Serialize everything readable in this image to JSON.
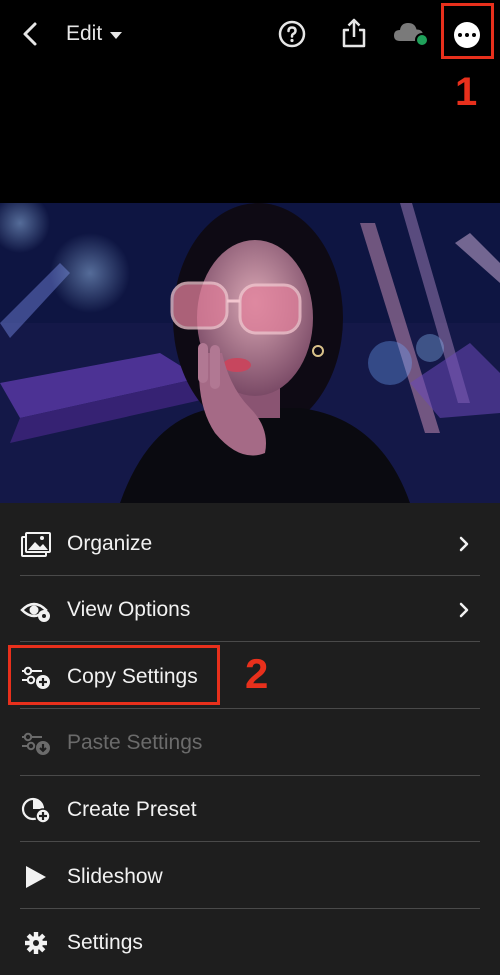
{
  "topbar": {
    "title": "Edit",
    "icons": [
      "back-arrow-icon",
      "caret-down-icon",
      "help-icon",
      "share-icon",
      "cloud-sync-icon",
      "more-icon"
    ],
    "sync_status_color": "#1fa15a"
  },
  "annotations": {
    "step1": "1",
    "step2": "2",
    "color": "#e8301c"
  },
  "menu": {
    "items": [
      {
        "label": "Organize",
        "icon": "organize-icon",
        "has_chevron": true,
        "enabled": true
      },
      {
        "label": "View Options",
        "icon": "view-options-icon",
        "has_chevron": true,
        "enabled": true
      },
      {
        "label": "Copy Settings",
        "icon": "copy-settings-icon",
        "has_chevron": false,
        "enabled": true
      },
      {
        "label": "Paste Settings",
        "icon": "paste-settings-icon",
        "has_chevron": false,
        "enabled": false
      },
      {
        "label": "Create Preset",
        "icon": "create-preset-icon",
        "has_chevron": false,
        "enabled": true
      },
      {
        "label": "Slideshow",
        "icon": "play-icon",
        "has_chevron": false,
        "enabled": true
      },
      {
        "label": "Settings",
        "icon": "gear-icon",
        "has_chevron": false,
        "enabled": true
      }
    ]
  }
}
